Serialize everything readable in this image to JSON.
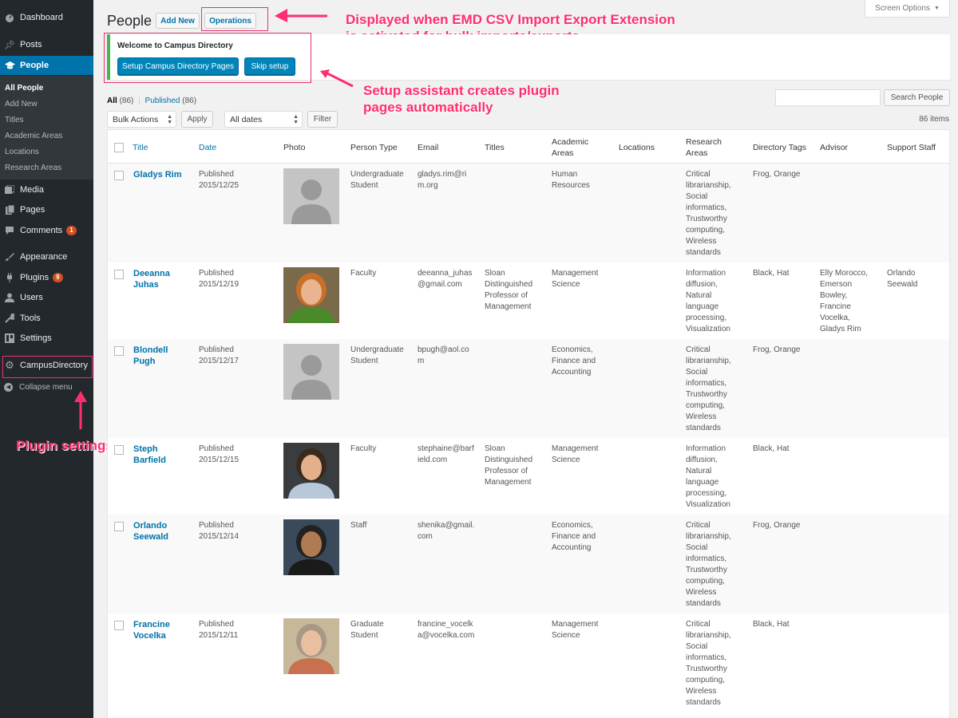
{
  "sidebar": {
    "dashboard": "Dashboard",
    "posts": "Posts",
    "people": "People",
    "submenu": [
      "All People",
      "Add New",
      "Titles",
      "Academic Areas",
      "Locations",
      "Research Areas"
    ],
    "media": "Media",
    "pages": "Pages",
    "comments": "Comments",
    "comments_badge": "1",
    "appearance": "Appearance",
    "plugins": "Plugins",
    "plugins_badge": "9",
    "users": "Users",
    "tools": "Tools",
    "settings": "Settings",
    "campus_directory": "CampusDirectory",
    "collapse": "Collapse menu"
  },
  "header": {
    "title": "People",
    "add_new": "Add New",
    "operations": "Operations",
    "screen_options": "Screen Options"
  },
  "welcome": {
    "title": "Welcome to Campus Directory",
    "setup_button": "Setup Campus Directory Pages",
    "skip_button": "Skip setup"
  },
  "annotations": {
    "operations_note": "Displayed when EMD CSV Import Export Extension is activated for bulk imports/exports",
    "setup_note": "Setup assistant creates plugin pages automatically",
    "plugin_note": "Plugin settings"
  },
  "filters": {
    "all_label": "All",
    "all_count": "(86)",
    "separator": "|",
    "published_label": "Published",
    "published_count": "(86)",
    "bulk_actions": "Bulk Actions",
    "apply": "Apply",
    "all_dates": "All dates",
    "filter": "Filter",
    "search_placeholder": "",
    "search_button": "Search People",
    "items_count": "86 items"
  },
  "table": {
    "columns": [
      "Title",
      "Date",
      "Photo",
      "Person Type",
      "Email",
      "Titles",
      "Academic Areas",
      "Locations",
      "Research Areas",
      "Directory Tags",
      "Advisor",
      "Support Staff"
    ],
    "rows": [
      {
        "name": "Gladys Rim",
        "status": "Published",
        "date": "2015/12/25",
        "photo": "placeholder",
        "type": "Undergraduate Student",
        "email": "gladys.rim@rim.org",
        "titles": "",
        "academic": "Human Resources",
        "locations": "",
        "research": "Critical librarianship, Social informatics, Trustworthy computing, Wireless standards",
        "tags": "Frog, Orange",
        "advisor": "",
        "staff": ""
      },
      {
        "name": "Deeanna Juhas",
        "status": "Published",
        "date": "2015/12/19",
        "photo": "woman-red-hair",
        "type": "Faculty",
        "email": "deeanna_juhas@gmail.com",
        "titles": "Sloan Distinguished Professor of Management",
        "academic": "Management Science",
        "locations": "",
        "research": "Information diffusion, Natural language processing, Visualization",
        "tags": "Black, Hat",
        "advisor": "Elly Morocco, Emerson Bowley, Francine Vocelka, Gladys Rim",
        "staff": "Orlando Seewald"
      },
      {
        "name": "Blondell Pugh",
        "status": "Published",
        "date": "2015/12/17",
        "photo": "placeholder",
        "type": "Undergraduate Student",
        "email": "bpugh@aol.com",
        "titles": "",
        "academic": "Economics, Finance and Accounting",
        "locations": "",
        "research": "Critical librarianship, Social informatics, Trustworthy computing, Wireless standards",
        "tags": "Frog, Orange",
        "advisor": "",
        "staff": ""
      },
      {
        "name": "Steph Barfield",
        "status": "Published",
        "date": "2015/12/15",
        "photo": "man-smiling",
        "type": "Faculty",
        "email": "stephaine@barfield.com",
        "titles": "Sloan Distinguished Professor of Management",
        "academic": "Management Science",
        "locations": "",
        "research": "Information diffusion, Natural language processing, Visualization",
        "tags": "Black, Hat",
        "advisor": "",
        "staff": ""
      },
      {
        "name": "Orlando Seewald",
        "status": "Published",
        "date": "2015/12/14",
        "photo": "man-glasses",
        "type": "Staff",
        "email": "shenika@gmail.com",
        "titles": "",
        "academic": "Economics, Finance and Accounting",
        "locations": "",
        "research": "Critical librarianship, Social informatics, Trustworthy computing, Wireless standards",
        "tags": "Frog, Orange",
        "advisor": "",
        "staff": ""
      },
      {
        "name": "Francine Vocelka",
        "status": "Published",
        "date": "2015/12/11",
        "photo": "woman-curly",
        "type": "Graduate Student",
        "email": "francine_vocelka@vocelka.com",
        "titles": "",
        "academic": "Management Science",
        "locations": "",
        "research": "Critical librarianship, Social informatics, Trustworthy computing, Wireless standards",
        "tags": "Black, Hat",
        "advisor": "",
        "staff": ""
      }
    ]
  },
  "colors": {
    "accent": "#0073aa",
    "annotation": "#ff2e6e",
    "sidebar": "#23282d"
  }
}
